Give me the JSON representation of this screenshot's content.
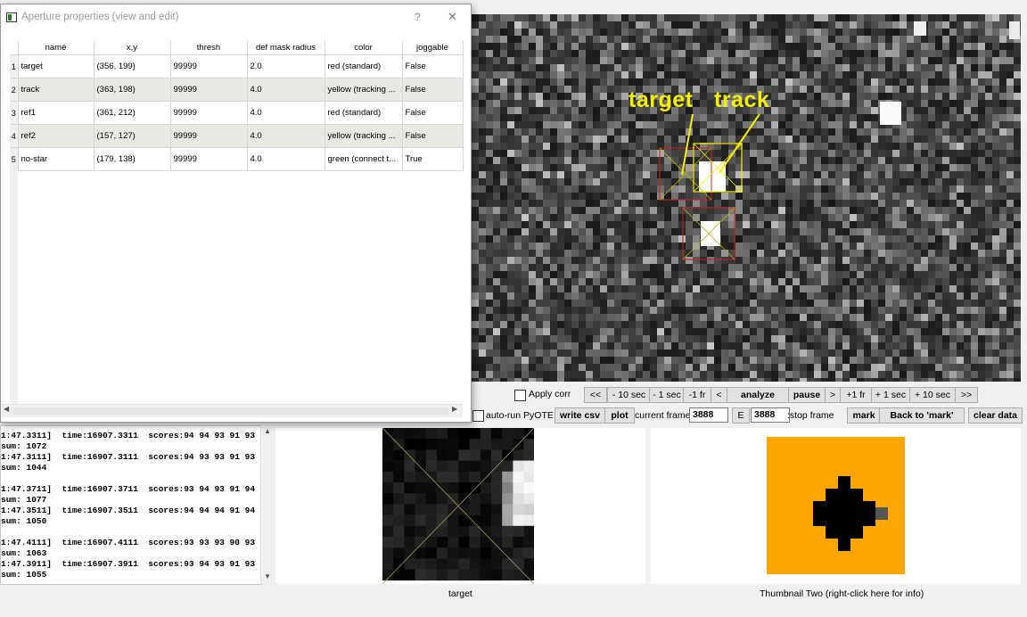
{
  "dialog": {
    "title": "Aperture properties (view and edit)",
    "help_glyph": "?",
    "close_glyph": "✕",
    "columns": [
      "name",
      "x,y",
      "thresh",
      "def mask radius",
      "color",
      "joggable"
    ],
    "rows": [
      {
        "num": "1",
        "name": "target",
        "xy": "(356, 199)",
        "thresh": "99999",
        "radius": "2.0",
        "color": "red (standard)",
        "joggable": "False"
      },
      {
        "num": "2",
        "name": "track",
        "xy": "(363, 198)",
        "thresh": "99999",
        "radius": "4.0",
        "color": "yellow (tracking ...",
        "joggable": "False"
      },
      {
        "num": "3",
        "name": "ref1",
        "xy": "(361, 212)",
        "thresh": "99999",
        "radius": "4.0",
        "color": "red (standard)",
        "joggable": "False"
      },
      {
        "num": "4",
        "name": "ref2",
        "xy": "(157, 127)",
        "thresh": "99999",
        "radius": "4.0",
        "color": "yellow (tracking ...",
        "joggable": "False"
      },
      {
        "num": "5",
        "name": "no-star",
        "xy": "(179, 138)",
        "thresh": "99999",
        "radius": "4.0",
        "color": "green (connect t...",
        "joggable": "True"
      }
    ]
  },
  "frame": {
    "label_target": "target",
    "label_track": "track",
    "label_color": "#f5f000"
  },
  "controls": {
    "apply_corr": "Apply corr",
    "rewind": "<<",
    "minus_10": "- 10 sec",
    "minus_1": "- 1 sec",
    "minus_fr": "-1 fr",
    "back": "<",
    "analyze": "analyze",
    "pause": "pause",
    "fwd": ">",
    "plus_fr": "+1 fr",
    "plus_1": "+ 1 sec",
    "plus_10": "+ 10 sec",
    "ffwd": ">>",
    "auto_run": "auto-run PyOTE",
    "write_csv": "write csv",
    "plot": "plot",
    "current_frame_label": "current frame:",
    "current_frame": "3888",
    "e_btn": "E",
    "stop_frame": "3888",
    "stop_frame_label": ":stop frame",
    "mark": "mark",
    "back_to_mark": "Back to 'mark'",
    "clear_data": "clear data"
  },
  "log": {
    "lines": [
      "1:47.3311]  time:16907.3311  scores:94 94 93 91 93",
      "sum: 1072",
      "1:47.3111]  time:16907.3111  scores:94 93 93 91 93",
      "sum: 1044",
      "",
      "1:47.3711]  time:16907.3711  scores:93 94 93 91 94",
      "sum: 1077",
      "1:47.3511]  time:16907.3511  scores:94 94 94 91 94",
      "sum: 1050",
      "",
      "1:47.4111]  time:16907.4111  scores:93 93 93 90 93",
      "sum: 1063",
      "1:47.3911]  time:16907.3911  scores:93 94 93 91 93",
      "sum: 1055"
    ]
  },
  "thumbnails": {
    "one_label": "target",
    "two_label": "Thumbnail Two (right-click here for info)",
    "two_bg": "#ffa500"
  }
}
